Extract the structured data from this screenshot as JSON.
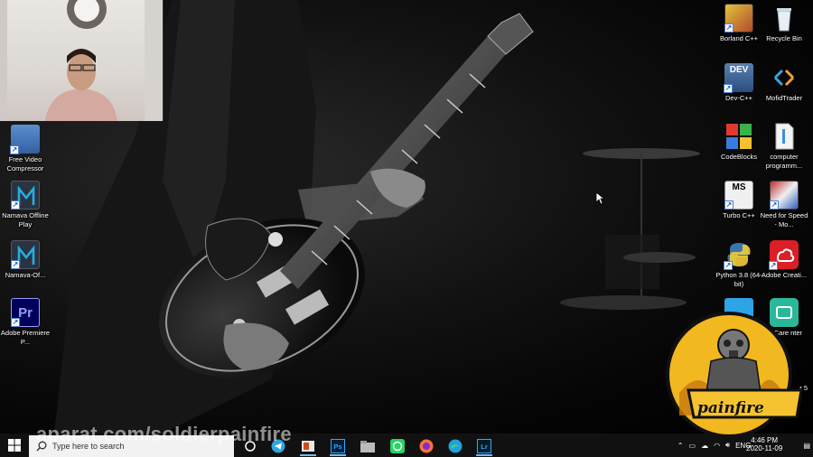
{
  "desktop": {
    "left_icons": [
      {
        "name": "free-video-compressor",
        "label": "Free Video Compressor",
        "icon": "monitor-icon"
      },
      {
        "name": "namava-offline-play",
        "label": "Namava Offline Play",
        "icon": "namava-icon"
      },
      {
        "name": "namava-offline",
        "label": "Namava-Of...",
        "icon": "namava-icon"
      },
      {
        "name": "adobe-premiere",
        "label": "Adobe Premiere P...",
        "icon": "premiere-icon"
      }
    ],
    "right_icons": [
      {
        "name": "borland-cpp",
        "label": "Borland C++"
      },
      {
        "name": "recycle-bin",
        "label": "Recycle Bin"
      },
      {
        "name": "dev-cpp",
        "label": "Dev-C++"
      },
      {
        "name": "mofidtrader",
        "label": "MofidTrader"
      },
      {
        "name": "codeblocks",
        "label": "CodeBlocks"
      },
      {
        "name": "computer-programming",
        "label": "computer programm..."
      },
      {
        "name": "turbo-cpp",
        "label": "Turbo C++"
      },
      {
        "name": "need-for-speed",
        "label": "Need for Speed - Mo..."
      },
      {
        "name": "python-38",
        "label": "Python 3.8 (64-bit)"
      },
      {
        "name": "adobe-creative",
        "label": "Adobe Creati..."
      },
      {
        "name": "user-care-center",
        "label": "er Care nter"
      },
      {
        "name": "partial-icon",
        "label": "r 5"
      }
    ]
  },
  "icon_labels": {
    "dev": "DEV",
    "ms": "MS",
    "pr": "Pr"
  },
  "watermark": "aparat.com/soldierpainfire",
  "logo_text": "painfire",
  "taskbar": {
    "search_placeholder": "Type here to search",
    "apps": [
      "telegram",
      "office",
      "photoshop",
      "file-explorer",
      "whatsapp",
      "firefox",
      "edge",
      "lightroom"
    ],
    "lightroom_label": "Lr",
    "photoshop_label": "Ps",
    "lang": "ENG",
    "time": "4:46 PM",
    "date": "2020-11-09"
  },
  "colors": {
    "taskbar": "#121212",
    "accent": "#76b9ed"
  }
}
